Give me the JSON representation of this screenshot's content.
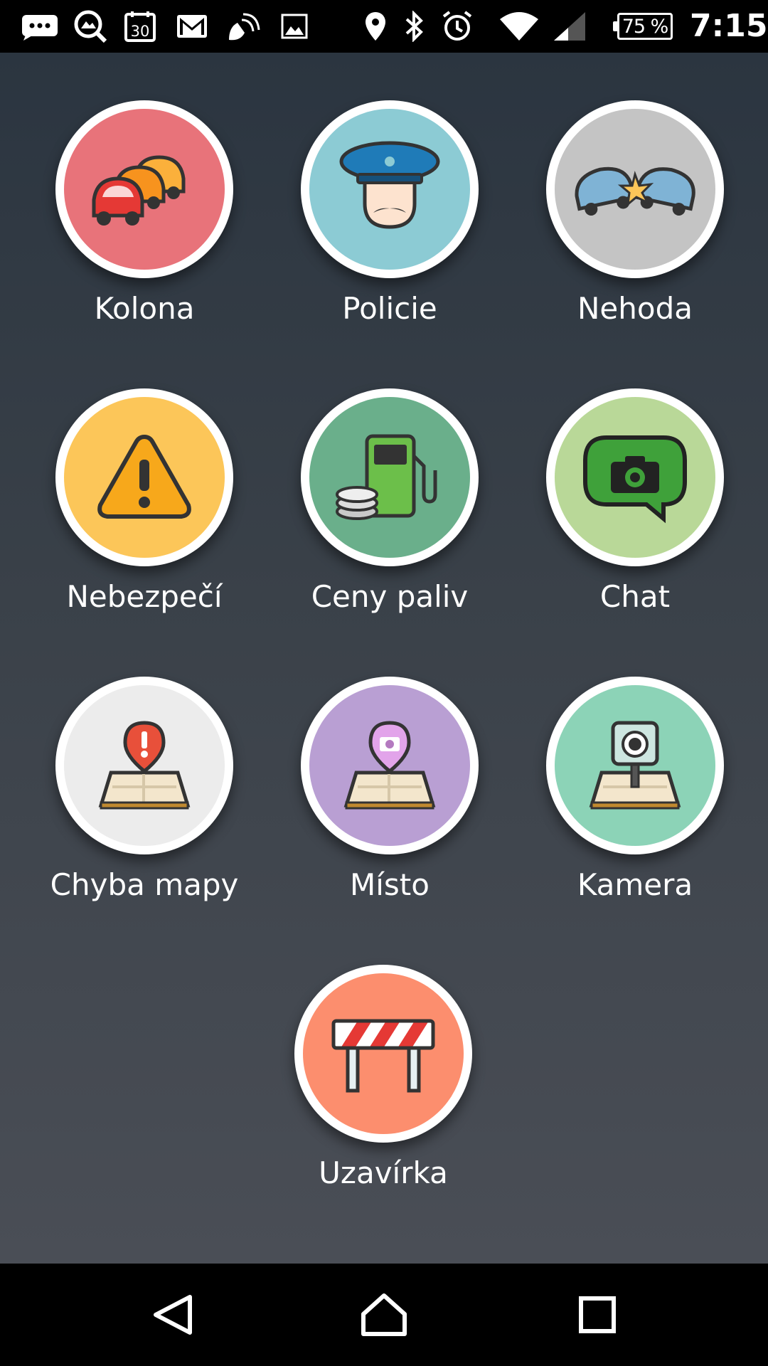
{
  "status_bar": {
    "icons": [
      "messaging-icon",
      "gallery-search-icon",
      "calendar-icon",
      "gmail-icon",
      "satellite-icon",
      "image-icon",
      "location-icon",
      "bluetooth-icon",
      "alarm-icon",
      "wifi-icon",
      "cellular-signal-icon"
    ],
    "calendar_day": "30",
    "battery_percent": "75 %",
    "time": "7:15"
  },
  "report_menu": {
    "items": [
      {
        "id": "kolona",
        "label": "Kolona",
        "icon": "traffic-jam-icon",
        "color": "#e8737a"
      },
      {
        "id": "policie",
        "label": "Policie",
        "icon": "police-icon",
        "color": "#8ccbd4"
      },
      {
        "id": "nehoda",
        "label": "Nehoda",
        "icon": "accident-icon",
        "color": "#c4c4c4"
      },
      {
        "id": "nebezpeci",
        "label": "Nebezpečí",
        "icon": "hazard-icon",
        "color": "#fcc659"
      },
      {
        "id": "ceny-paliv",
        "label": "Ceny paliv",
        "icon": "gas-station-icon",
        "color": "#6aaf8b"
      },
      {
        "id": "chat",
        "label": "Chat",
        "icon": "chat-camera-icon",
        "color": "#b9d898"
      },
      {
        "id": "chyba-mapy",
        "label": "Chyba mapy",
        "icon": "map-error-icon",
        "color": "#ececec"
      },
      {
        "id": "misto",
        "label": "Místo",
        "icon": "place-icon",
        "color": "#b99fd3"
      },
      {
        "id": "kamera",
        "label": "Kamera",
        "icon": "speed-camera-icon",
        "color": "#8cd3b7"
      },
      {
        "id": "uzavirka",
        "label": "Uzavírka",
        "icon": "road-closure-icon",
        "color": "#fc8e6e"
      }
    ]
  },
  "nav_bar": {
    "buttons": [
      "back-icon",
      "home-icon",
      "recents-icon"
    ]
  }
}
